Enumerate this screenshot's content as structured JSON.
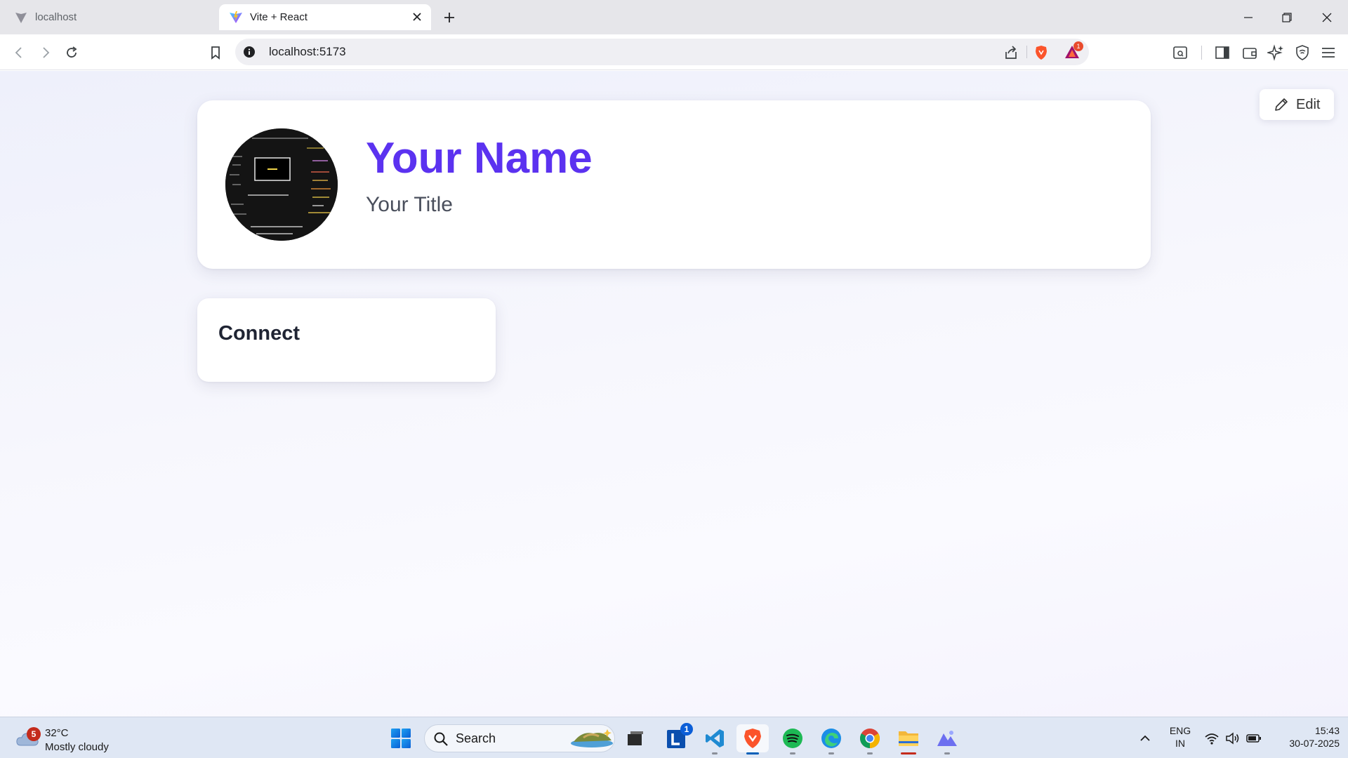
{
  "browser": {
    "tabs": [
      {
        "title": "localhost",
        "active": false
      },
      {
        "title": "Vite + React",
        "active": true
      }
    ],
    "address": "localhost:5173",
    "notification_count": "1"
  },
  "page": {
    "edit_label": "Edit",
    "profile": {
      "name": "Your Name",
      "title": "Your Title"
    },
    "connect": {
      "heading": "Connect"
    }
  },
  "taskbar": {
    "weather": {
      "badge": "5",
      "temp": "32°C",
      "condition": "Mostly cloudy"
    },
    "search_label": "Search",
    "apps": [
      "task-view",
      "libre-office",
      "vscode",
      "brave",
      "spotify",
      "edge",
      "chrome",
      "file-explorer",
      "photos"
    ],
    "app_badge": "1",
    "language": {
      "line1": "ENG",
      "line2": "IN"
    },
    "clock": {
      "time": "15:43",
      "date": "30-07-2025"
    }
  },
  "colors": {
    "accent": "#5b32f0",
    "title_text": "#4a4f5c",
    "heading_text": "#1f2433",
    "page_bg": "#f4f4fc"
  }
}
